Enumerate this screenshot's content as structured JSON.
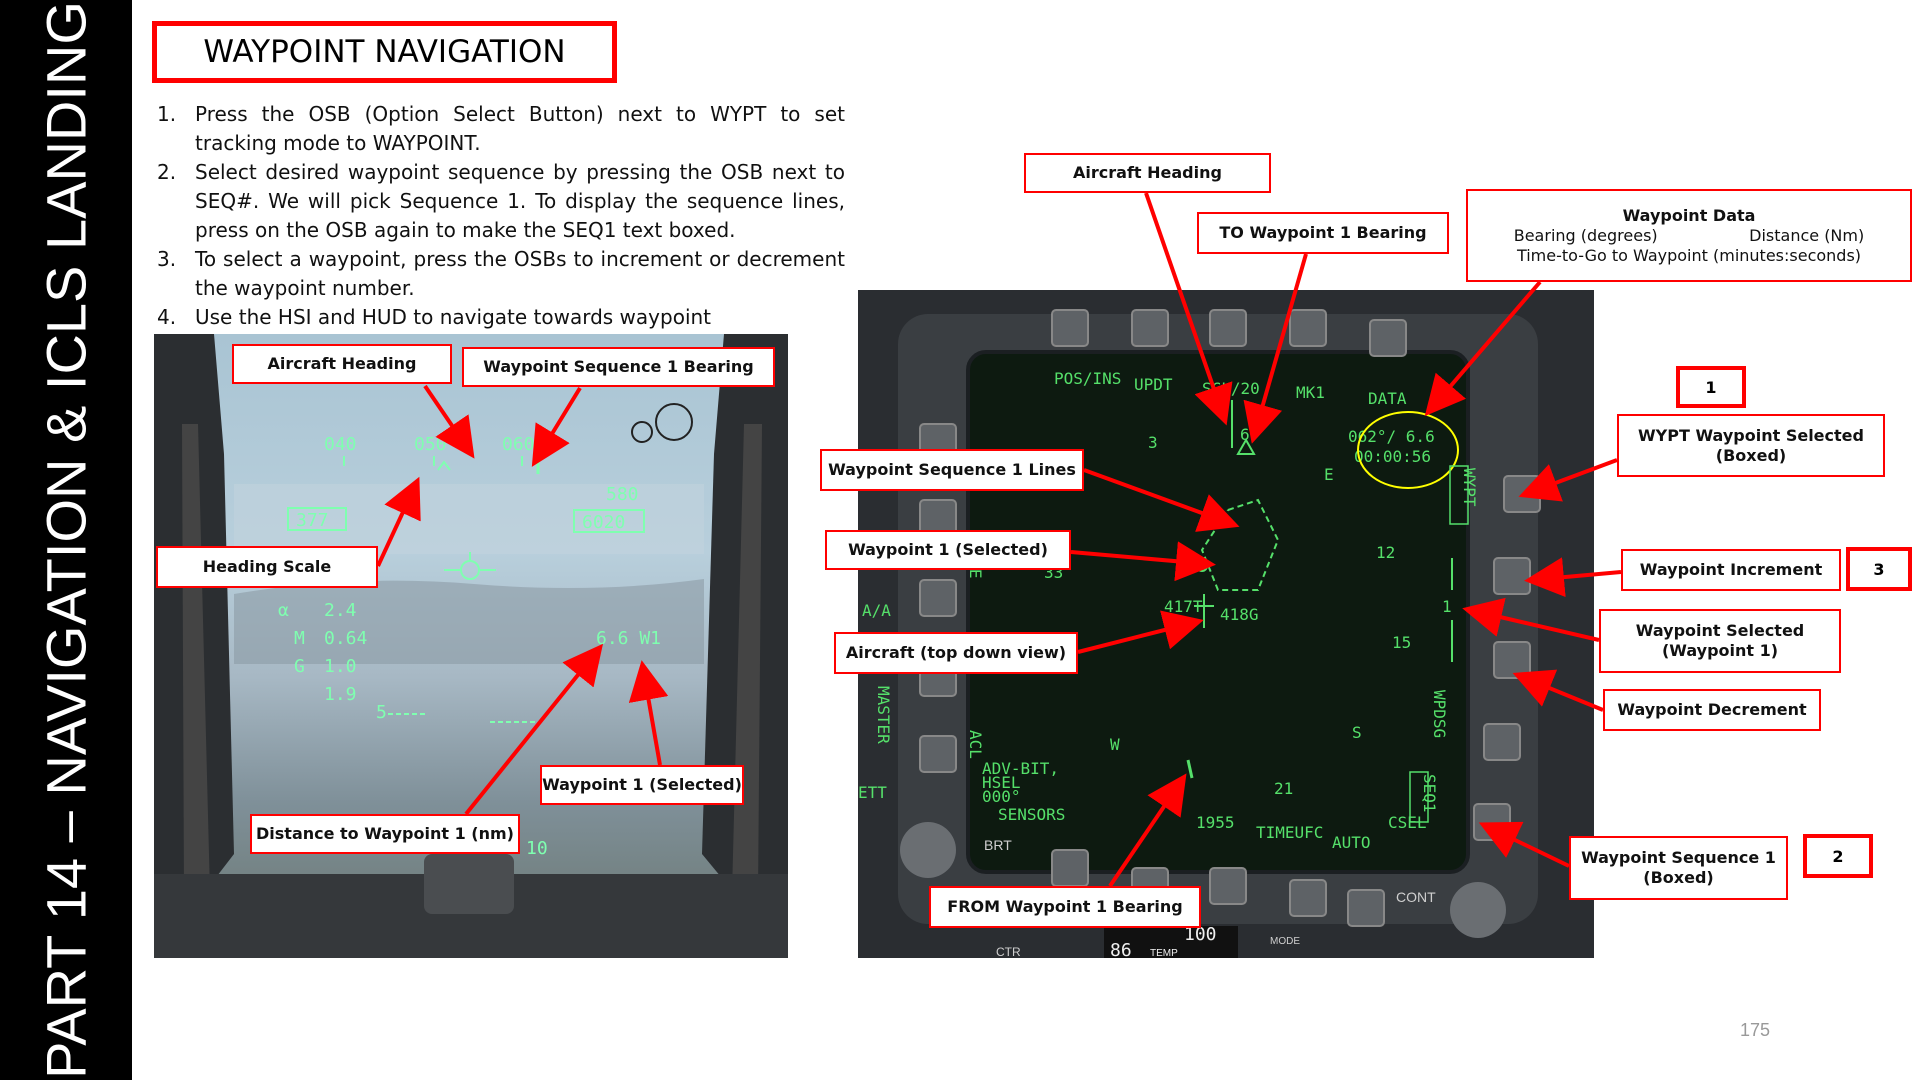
{
  "side_title": "PART 14 – NAVIGATION & ICLS LANDING",
  "slide_title": "WAYPOINT NAVIGATION",
  "steps": [
    {
      "num": "1.",
      "text": "Press the OSB (Option Select Button) next to WYPT to set tracking mode to WAYPOINT."
    },
    {
      "num": "2.",
      "text": "Select desired waypoint sequence by pressing the OSB next to SEQ#. We will pick Sequence 1. To display the sequence lines, press on the OSB again to make the SEQ1 text boxed."
    },
    {
      "num": "3.",
      "text": "To select a waypoint, press the OSBs to increment or decrement the waypoint number."
    },
    {
      "num": "4.",
      "text": "Use the HSI and HUD to navigate towards waypoint"
    }
  ],
  "hud_callouts": {
    "aircraft_heading": "Aircraft Heading",
    "seq1_bearing": "Waypoint Sequence 1 Bearing",
    "heading_scale": "Heading Scale",
    "waypoint1_selected": "Waypoint 1 (Selected)",
    "distance_wp1": "Distance to Waypoint 1 (nm)"
  },
  "hud_readouts": {
    "hdg_040": "040",
    "hdg_050": "050",
    "hdg_060": "060",
    "speed": "377",
    "alt_top": "580",
    "alt": "6020",
    "alpha": "2.4",
    "mach": "0.64",
    "g": "1.0",
    "peak_g": "1.9",
    "wp_distance": "6.6 W1",
    "scale_5": "5",
    "bottom_10": "10"
  },
  "ddi_callouts": {
    "aircraft_heading": "Aircraft Heading",
    "to_wp1_bearing": "TO Waypoint 1 Bearing",
    "waypoint_data_title": "Waypoint Data",
    "waypoint_data_bearing": "Bearing (degrees)",
    "waypoint_data_distance": "Distance (Nm)",
    "waypoint_data_ttg": "Time-to-Go to Waypoint (minutes:seconds)",
    "seq1_lines": "Waypoint Sequence 1 Lines",
    "wp1_selected": "Waypoint 1 (Selected)",
    "aircraft_topdown": "Aircraft (top down view)",
    "wypt_selected": "WYPT Waypoint Selected (Boxed)",
    "wp_increment": "Waypoint Increment",
    "wp_selected": "Waypoint Selected (Waypoint 1)",
    "wp_decrement": "Waypoint Decrement",
    "seq1_boxed": "Waypoint Sequence 1 (Boxed)",
    "from_wp1_bearing": "FROM Waypoint 1 Bearing"
  },
  "step_badges": {
    "one": "1",
    "three": "3",
    "two": "2"
  },
  "ddi_readouts": {
    "pos_ins": "POS/INS",
    "updt": "UPDT",
    "scl": "SCL/20",
    "mk1": "MK1",
    "data": "DATA",
    "bearing_dist": "062°/ 6.6",
    "ttg": "00:00:56",
    "wypt": "WYPT",
    "wpdsg": "WPDSG",
    "seq1": "SEQ1",
    "n3": "3",
    "n6": "6",
    "e": "E",
    "n12": "12",
    "n15": "15",
    "n33": "33",
    "s": "S",
    "w": "W",
    "n21": "21",
    "lbl_417t": "417T",
    "lbl_418g": "418G",
    "wp_num": "1",
    "aa": "A/A",
    "mode": "MODE",
    "master": "MASTER",
    "ett": "ETT",
    "adv_bit": "ADV-BIT,",
    "hsel": "HSEL",
    "d000": "000°",
    "sensors": "SENSORS",
    "acl": "ACL",
    "time1955": "1955",
    "timeufc": "TIMEUFC",
    "auto": "AUTO",
    "csel": "CSEL",
    "brt": "BRT",
    "cont": "CONT",
    "ctr": "CTR",
    "ufc_100": "100",
    "ufc_86": "86",
    "temp": "TEMP",
    "mode_btn": "MODE"
  },
  "page_number": "175",
  "colors": {
    "accent": "#ff0000",
    "hud_symbology": "#7fffb0",
    "ddi_symbology": "#55e06a",
    "ring": "#ffff00"
  }
}
